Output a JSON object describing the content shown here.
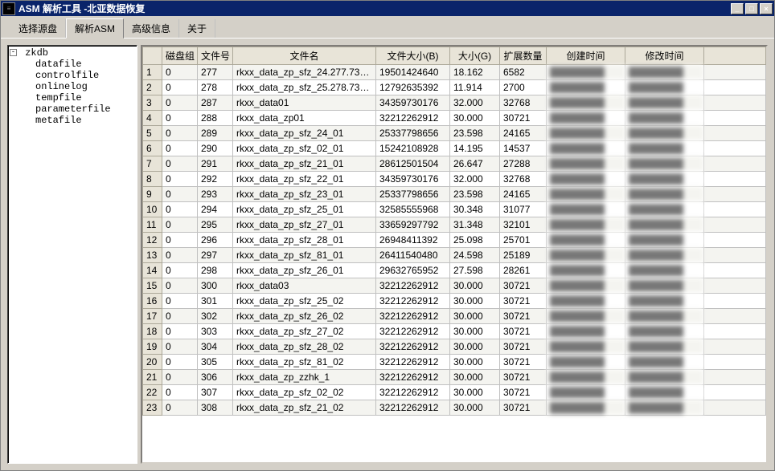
{
  "title": "ASM 解析工具 -北亚数据恢复",
  "win_buttons": {
    "min": "_",
    "max": "□",
    "close": "×"
  },
  "tabs": [
    {
      "label": "选择源盘"
    },
    {
      "label": "解析ASM"
    },
    {
      "label": "高级信息"
    },
    {
      "label": "关于"
    }
  ],
  "active_tab_index": 1,
  "tree": {
    "root": "zkdb",
    "children": [
      "datafile",
      "controlfile",
      "onlinelog",
      "tempfile",
      "parameterfile",
      "metafile"
    ]
  },
  "columns": {
    "rownum": "",
    "group": "磁盘组",
    "fileno": "文件号",
    "fname": "文件名",
    "sizeB": "文件大小(B)",
    "sizeG": "大小(G)",
    "ext": "扩展数量",
    "ctime": "创建时间",
    "mtime": "修改时间"
  },
  "rows": [
    {
      "group": "0",
      "fileno": "277",
      "fname": "rkxx_data_zp_sfz_24.277.73…",
      "sizeB": "19501424640",
      "sizeG": "18.162",
      "ext": "6582"
    },
    {
      "group": "0",
      "fileno": "278",
      "fname": "rkxx_data_zp_sfz_25.278.73…",
      "sizeB": "12792635392",
      "sizeG": "11.914",
      "ext": "2700"
    },
    {
      "group": "0",
      "fileno": "287",
      "fname": "rkxx_data01",
      "sizeB": "34359730176",
      "sizeG": "32.000",
      "ext": "32768"
    },
    {
      "group": "0",
      "fileno": "288",
      "fname": "rkxx_data_zp01",
      "sizeB": "32212262912",
      "sizeG": "30.000",
      "ext": "30721"
    },
    {
      "group": "0",
      "fileno": "289",
      "fname": "rkxx_data_zp_sfz_24_01",
      "sizeB": "25337798656",
      "sizeG": "23.598",
      "ext": "24165"
    },
    {
      "group": "0",
      "fileno": "290",
      "fname": "rkxx_data_zp_sfz_02_01",
      "sizeB": "15242108928",
      "sizeG": "14.195",
      "ext": "14537"
    },
    {
      "group": "0",
      "fileno": "291",
      "fname": "rkxx_data_zp_sfz_21_01",
      "sizeB": "28612501504",
      "sizeG": "26.647",
      "ext": "27288"
    },
    {
      "group": "0",
      "fileno": "292",
      "fname": "rkxx_data_zp_sfz_22_01",
      "sizeB": "34359730176",
      "sizeG": "32.000",
      "ext": "32768"
    },
    {
      "group": "0",
      "fileno": "293",
      "fname": "rkxx_data_zp_sfz_23_01",
      "sizeB": "25337798656",
      "sizeG": "23.598",
      "ext": "24165"
    },
    {
      "group": "0",
      "fileno": "294",
      "fname": "rkxx_data_zp_sfz_25_01",
      "sizeB": "32585555968",
      "sizeG": "30.348",
      "ext": "31077"
    },
    {
      "group": "0",
      "fileno": "295",
      "fname": "rkxx_data_zp_sfz_27_01",
      "sizeB": "33659297792",
      "sizeG": "31.348",
      "ext": "32101"
    },
    {
      "group": "0",
      "fileno": "296",
      "fname": "rkxx_data_zp_sfz_28_01",
      "sizeB": "26948411392",
      "sizeG": "25.098",
      "ext": "25701"
    },
    {
      "group": "0",
      "fileno": "297",
      "fname": "rkxx_data_zp_sfz_81_01",
      "sizeB": "26411540480",
      "sizeG": "24.598",
      "ext": "25189"
    },
    {
      "group": "0",
      "fileno": "298",
      "fname": "rkxx_data_zp_sfz_26_01",
      "sizeB": "29632765952",
      "sizeG": "27.598",
      "ext": "28261"
    },
    {
      "group": "0",
      "fileno": "300",
      "fname": "rkxx_data03",
      "sizeB": "32212262912",
      "sizeG": "30.000",
      "ext": "30721"
    },
    {
      "group": "0",
      "fileno": "301",
      "fname": "rkxx_data_zp_sfz_25_02",
      "sizeB": "32212262912",
      "sizeG": "30.000",
      "ext": "30721"
    },
    {
      "group": "0",
      "fileno": "302",
      "fname": "rkxx_data_zp_sfz_26_02",
      "sizeB": "32212262912",
      "sizeG": "30.000",
      "ext": "30721"
    },
    {
      "group": "0",
      "fileno": "303",
      "fname": "rkxx_data_zp_sfz_27_02",
      "sizeB": "32212262912",
      "sizeG": "30.000",
      "ext": "30721"
    },
    {
      "group": "0",
      "fileno": "304",
      "fname": "rkxx_data_zp_sfz_28_02",
      "sizeB": "32212262912",
      "sizeG": "30.000",
      "ext": "30721"
    },
    {
      "group": "0",
      "fileno": "305",
      "fname": "rkxx_data_zp_sfz_81_02",
      "sizeB": "32212262912",
      "sizeG": "30.000",
      "ext": "30721"
    },
    {
      "group": "0",
      "fileno": "306",
      "fname": "rkxx_data_zp_zzhk_1",
      "sizeB": "32212262912",
      "sizeG": "30.000",
      "ext": "30721"
    },
    {
      "group": "0",
      "fileno": "307",
      "fname": "rkxx_data_zp_sfz_02_02",
      "sizeB": "32212262912",
      "sizeG": "30.000",
      "ext": "30721"
    },
    {
      "group": "0",
      "fileno": "308",
      "fname": "rkxx_data_zp_sfz_21_02",
      "sizeB": "32212262912",
      "sizeG": "30.000",
      "ext": "30721"
    }
  ],
  "blur_placeholder": "████████"
}
